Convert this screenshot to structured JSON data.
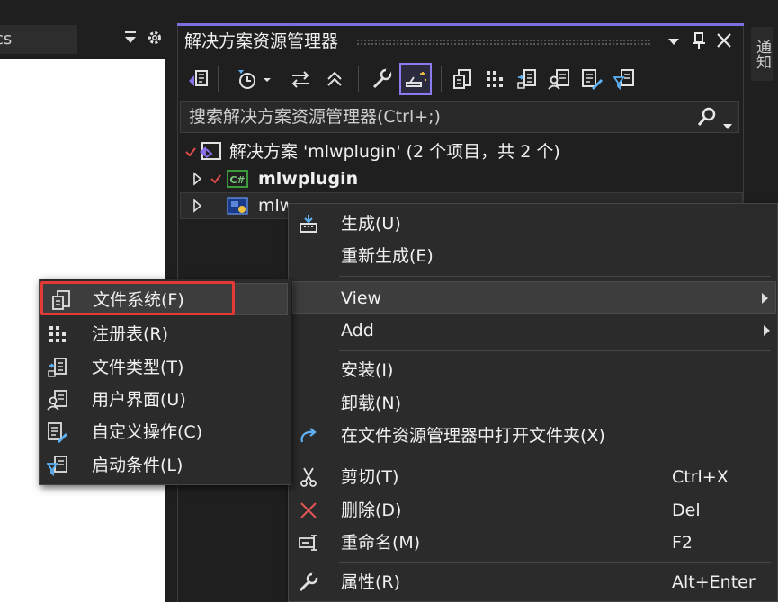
{
  "left_panel": {
    "tab_label": "cs"
  },
  "solution_explorer": {
    "title": "解决方案资源管理器",
    "search_placeholder": "搜索解决方案资源管理器(Ctrl+;)",
    "tree": {
      "solution_label": "解决方案 'mlwplugin' (2 个项目，共 2 个)",
      "project_label": "mlwplugin",
      "setup_label": "mlwpluginSetup"
    }
  },
  "right_tab": {
    "label": "通知"
  },
  "context_menu": {
    "items": [
      {
        "label": "生成(U)",
        "shortcut": ""
      },
      {
        "label": "重新生成(E)",
        "shortcut": ""
      },
      {
        "label": "View",
        "shortcut": ""
      },
      {
        "label": "Add",
        "shortcut": ""
      },
      {
        "label": "安装(I)",
        "shortcut": ""
      },
      {
        "label": "卸载(N)",
        "shortcut": ""
      },
      {
        "label": "在文件资源管理器中打开文件夹(X)",
        "shortcut": ""
      },
      {
        "label": "剪切(T)",
        "shortcut": "Ctrl+X"
      },
      {
        "label": "删除(D)",
        "shortcut": "Del"
      },
      {
        "label": "重命名(M)",
        "shortcut": "F2"
      },
      {
        "label": "属性(R)",
        "shortcut": "Alt+Enter"
      }
    ]
  },
  "view_submenu": {
    "items": [
      {
        "label": "文件系统(F)"
      },
      {
        "label": "注册表(R)"
      },
      {
        "label": "文件类型(T)"
      },
      {
        "label": "用户界面(U)"
      },
      {
        "label": "自定义操作(C)"
      },
      {
        "label": "启动条件(L)"
      }
    ]
  },
  "colors": {
    "accent": "#7b6fe0",
    "highlight_outline": "#e53935",
    "icon_blue": "#5fb2f5",
    "check_red": "#e04a4a",
    "delete_red": "#e05555"
  }
}
